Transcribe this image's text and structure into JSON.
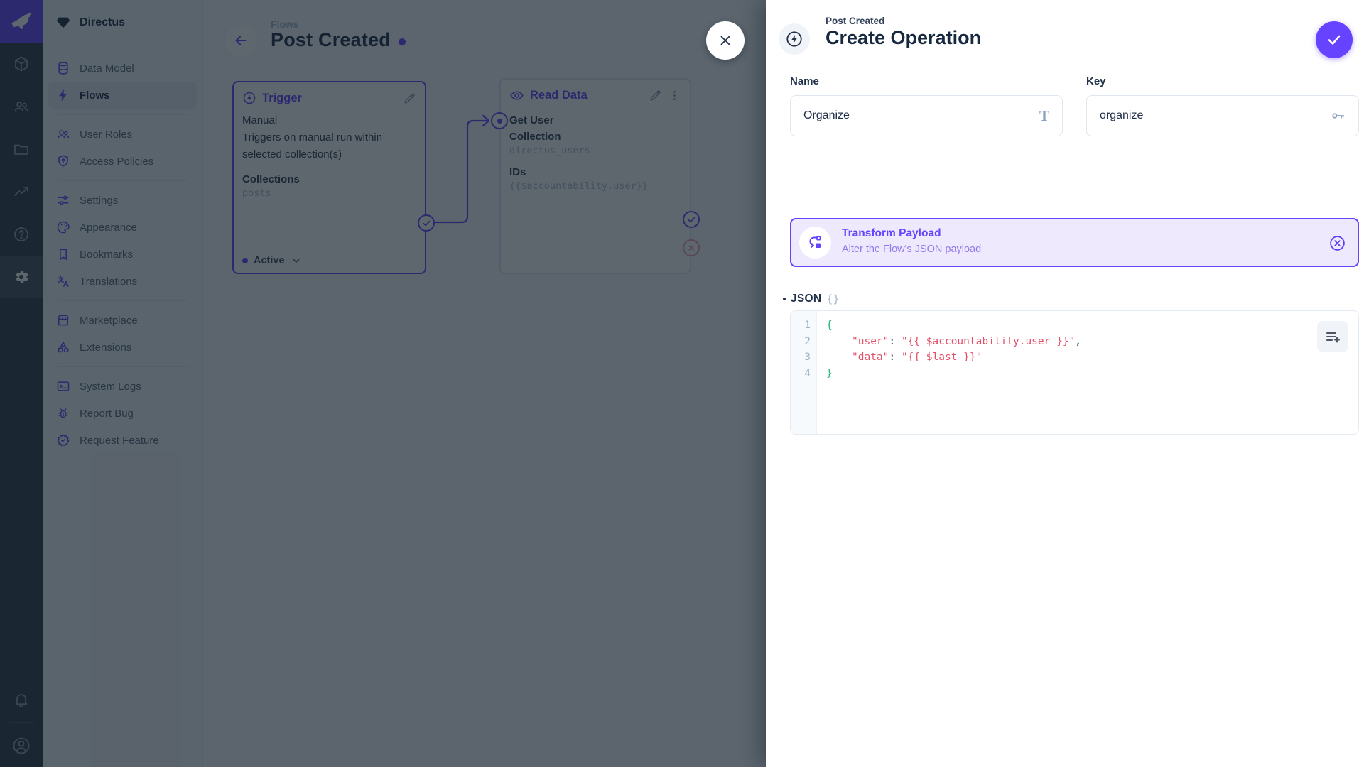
{
  "colors": {
    "accent": "#6644FF",
    "green": "#2CB57C",
    "red": "#E35169",
    "text_dark": "#172940",
    "subdued": "#A2B5CD"
  },
  "sidebar": {
    "project_name": "Directus",
    "items": [
      {
        "label": "Data Model"
      },
      {
        "label": "Flows"
      },
      {
        "label": "User Roles"
      },
      {
        "label": "Access Policies"
      },
      {
        "label": "Settings"
      },
      {
        "label": "Appearance"
      },
      {
        "label": "Bookmarks"
      },
      {
        "label": "Translations"
      },
      {
        "label": "Marketplace"
      },
      {
        "label": "Extensions"
      },
      {
        "label": "System Logs"
      },
      {
        "label": "Report Bug"
      },
      {
        "label": "Request Feature"
      }
    ]
  },
  "canvas": {
    "breadcrumb": "Flows",
    "title": "Post Created",
    "trigger_panel": {
      "title": "Trigger",
      "type": "Manual",
      "description": "Triggers on manual run within selected collection(s)",
      "collections_label": "Collections",
      "collections_value": "posts",
      "status_label": "Active"
    },
    "read_panel": {
      "title": "Read Data",
      "name": "Get User",
      "collection_label": "Collection",
      "collection_value": "directus_users",
      "ids_label": "IDs",
      "ids_value": "{{$accountability.user}}"
    }
  },
  "drawer": {
    "breadcrumb": "Post Created",
    "title": "Create Operation",
    "name_field": {
      "label": "Name",
      "value": "Organize",
      "icon_glyph": "T"
    },
    "key_field": {
      "label": "Key",
      "value": "organize"
    },
    "selected_operation": {
      "title": "Transform Payload",
      "subtitle": "Alter the Flow's JSON payload"
    },
    "json_field": {
      "label": "JSON",
      "icon_glyph": "{}"
    },
    "editor": {
      "line_numbers": [
        "1",
        "2",
        "3",
        "4"
      ],
      "open_brace": "{",
      "close_brace": "}",
      "line2": {
        "key": "\"user\"",
        "colon": ": ",
        "value": "\"{{ $accountability.user }}\"",
        "comma": ","
      },
      "line3": {
        "key": "\"data\"",
        "colon": ": ",
        "value": "\"{{ $last }}\""
      }
    }
  }
}
